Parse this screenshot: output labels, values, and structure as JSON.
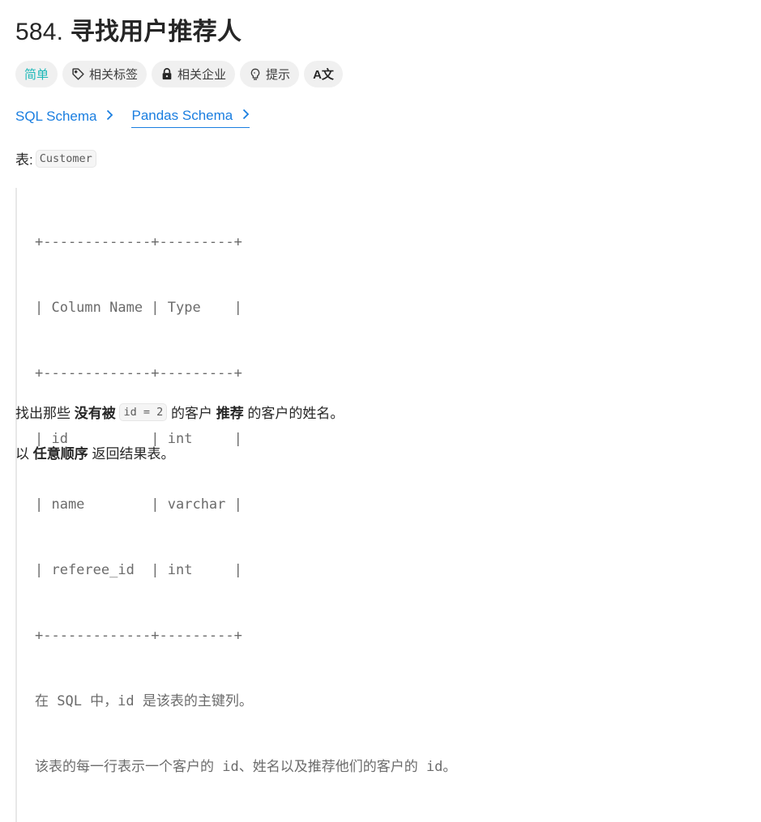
{
  "problem": {
    "number": "584.",
    "title": "寻找用户推荐人"
  },
  "tags": [
    {
      "label": "简单",
      "icon": null,
      "color": "#1cb8b8"
    },
    {
      "label": "相关标签",
      "icon": "tag-icon"
    },
    {
      "label": "相关企业",
      "icon": "lock-icon"
    },
    {
      "label": "提示",
      "icon": "lightbulb-icon"
    },
    {
      "label": "",
      "icon": "translate-icon",
      "icon_text": "A文"
    }
  ],
  "schema_tabs": [
    {
      "label": "SQL Schema",
      "active": false
    },
    {
      "label": "Pandas Schema",
      "active": true
    }
  ],
  "table_label": "表:",
  "table_name": "Customer",
  "schema_table": {
    "lines": [
      "+-------------+---------+",
      "| Column Name | Type    |",
      "+-------------+---------+",
      "| id          | int     |",
      "| name        | varchar |",
      "| referee_id  | int     |",
      "+-------------+---------+"
    ],
    "columns": [
      "Column Name",
      "Type"
    ],
    "rows": [
      [
        "id",
        "int"
      ],
      [
        "name",
        "varchar"
      ],
      [
        "referee_id",
        "int"
      ]
    ],
    "notes": [
      "在 SQL 中，id 是该表的主键列。",
      "该表的每一行表示一个客户的 id、姓名以及推荐他们的客户的 id。"
    ]
  },
  "description": {
    "p1_prefix": "找出那些 ",
    "p1_bold1": "没有被",
    "p1_code": "id = 2",
    "p1_mid": " 的客户 ",
    "p1_bold2": "推荐",
    "p1_suffix": " 的客户的姓名。",
    "p2_prefix": "以 ",
    "p2_bold": "任意顺序",
    "p2_suffix": " 返回结果表。"
  }
}
